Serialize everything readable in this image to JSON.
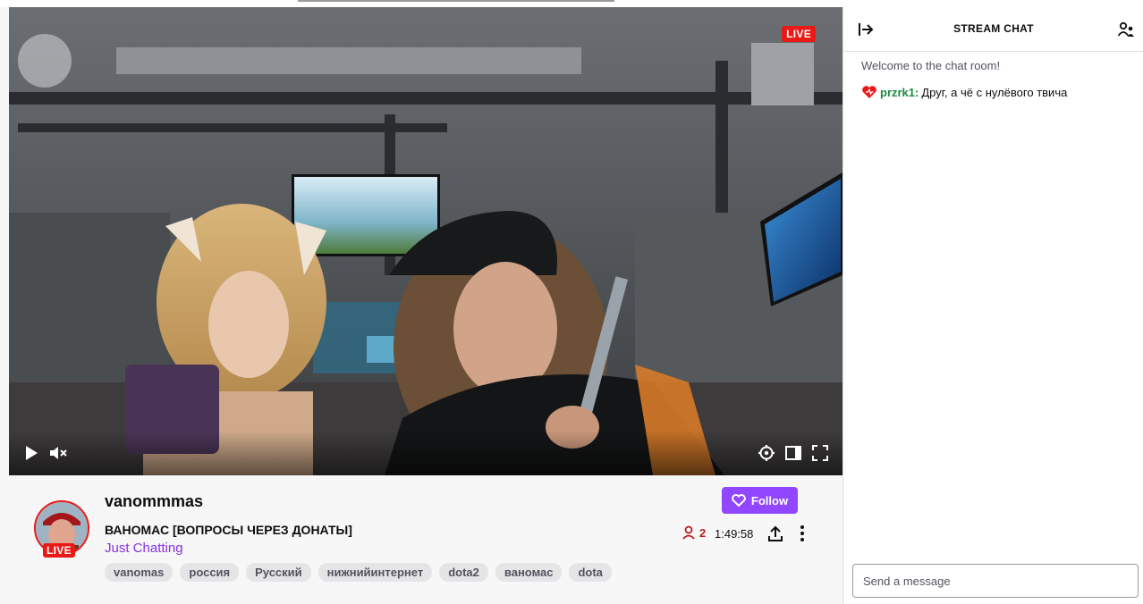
{
  "video": {
    "live_badge": "LIVE",
    "controls": [
      "play-icon",
      "mute-icon",
      "settings-icon",
      "theater-mode-icon",
      "fullscreen-icon"
    ]
  },
  "channel": {
    "name": "vanommmas",
    "avatar_live": "LIVE",
    "title": "ВАНОМАС [ВОПРОСЫ ЧЕРЕЗ ДОНАТЫ]",
    "category": "Just Chatting",
    "tags": [
      "vanomas",
      "россия",
      "Русский",
      "нижнийинтернет",
      "dota2",
      "ваномас",
      "dota"
    ],
    "follow_label": "Follow",
    "viewers": "2",
    "uptime": "1:49:58"
  },
  "chat": {
    "title": "STREAM CHAT",
    "welcome": "Welcome to the chat room!",
    "messages": [
      {
        "user": "przrk1:",
        "text": "Друг, а чё с нулёвого твича",
        "badge": "heart-badge-icon",
        "user_color": "#1a8a3f"
      }
    ],
    "input_placeholder": "Send a message"
  },
  "colors": {
    "accent": "#9147ff",
    "live": "#e91916",
    "category": "#8b2fe6"
  }
}
